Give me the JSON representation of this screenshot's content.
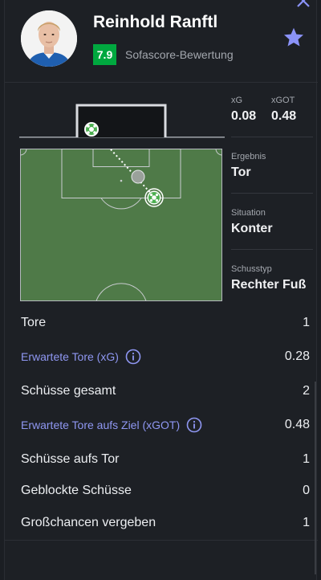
{
  "header": {
    "player_name": "Reinhold Ranftl",
    "rating": "7.9",
    "rating_label": "Sofascore-Bewertung",
    "colors": {
      "rating_bg": "#00a83f",
      "star": "#8b93f8"
    },
    "icons": [
      "close-icon",
      "star-icon",
      "player-avatar"
    ]
  },
  "shot": {
    "xg_label": "xG",
    "xg_value": "0.08",
    "xgot_label": "xGOT",
    "xgot_value": "0.48",
    "result_label": "Ergebnis",
    "result_value": "Tor",
    "situation_label": "Situation",
    "situation_value": "Konter",
    "shot_type_label": "Schusstyp",
    "shot_type_value": "Rechter Fuß"
  },
  "stats": [
    {
      "label": "Tore",
      "value": "1",
      "link": false
    },
    {
      "label": "Erwartete Tore (xG)",
      "value": "0.28",
      "link": true
    },
    {
      "label": "Schüsse gesamt",
      "value": "2",
      "link": false
    },
    {
      "label": "Erwartete Tore aufs Ziel (xGOT)",
      "value": "0.48",
      "link": true
    },
    {
      "label": "Schüsse aufs Tor",
      "value": "1",
      "link": false
    },
    {
      "label": "Geblockte Schüsse",
      "value": "0",
      "link": false
    },
    {
      "label": "Großchancen vergeben",
      "value": "1",
      "link": false
    }
  ]
}
